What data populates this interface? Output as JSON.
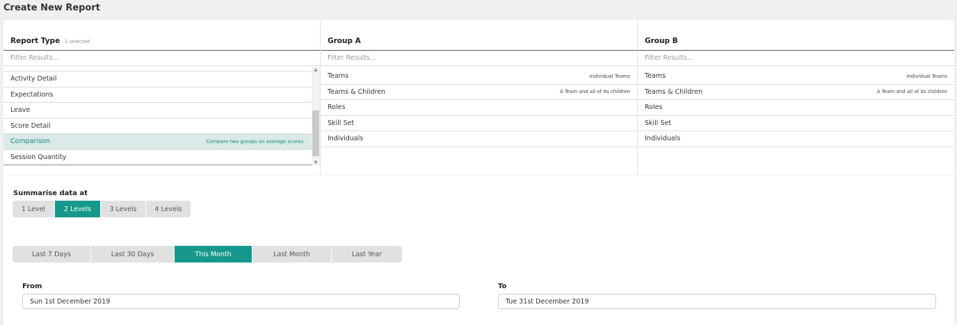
{
  "page": {
    "title": "Create New Report"
  },
  "report_type": {
    "header": "Report Type",
    "selected_count": "1 selected",
    "filter_placeholder": "Filter Results...",
    "items": [
      {
        "label": "Activity Detail",
        "hint": ""
      },
      {
        "label": "Expectations",
        "hint": ""
      },
      {
        "label": "Leave",
        "hint": ""
      },
      {
        "label": "Score Detail",
        "hint": ""
      },
      {
        "label": "Comparison",
        "hint": "Compare two groups on average scores",
        "selected": true
      },
      {
        "label": "Session Quantity",
        "hint": ""
      }
    ]
  },
  "group_a": {
    "header": "Group A",
    "filter_placeholder": "Filter Results...",
    "items": [
      {
        "label": "Teams",
        "hint": "Individual Teams"
      },
      {
        "label": "Teams & Children",
        "hint": "A Team and all of its children"
      },
      {
        "label": "Roles",
        "hint": ""
      },
      {
        "label": "Skill Set",
        "hint": ""
      },
      {
        "label": "Individuals",
        "hint": ""
      }
    ]
  },
  "group_b": {
    "header": "Group B",
    "filter_placeholder": "Filter Results...",
    "items": [
      {
        "label": "Teams",
        "hint": "Individual Teams"
      },
      {
        "label": "Teams & Children",
        "hint": "A Team and all of its children"
      },
      {
        "label": "Roles",
        "hint": ""
      },
      {
        "label": "Skill Set",
        "hint": ""
      },
      {
        "label": "Individuals",
        "hint": ""
      }
    ]
  },
  "summarise": {
    "label": "Summarise data at",
    "options": [
      "1 Level",
      "2 Levels",
      "3 Levels",
      "4 Levels"
    ],
    "selected": "2 Levels"
  },
  "date_range": {
    "options": [
      "Last 7 Days",
      "Last 30 Days",
      "This Month",
      "Last Month",
      "Last Year"
    ],
    "selected": "This Month"
  },
  "from": {
    "label": "From",
    "value": "Sun 1st December 2019"
  },
  "to": {
    "label": "To",
    "value": "Tue 31st December 2019"
  },
  "colors": {
    "accent": "#16988c",
    "selected_row_bg": "#d9eae8",
    "selected_text": "#15877c"
  },
  "icons": {
    "scroll_up": "chevron-up-icon",
    "scroll_down": "chevron-down-icon"
  }
}
